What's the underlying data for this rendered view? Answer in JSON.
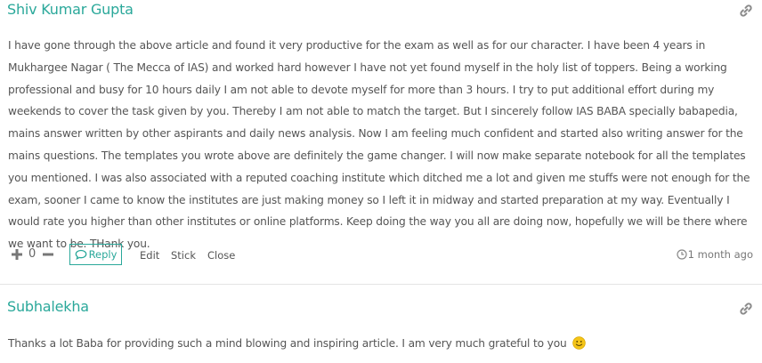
{
  "comments": [
    {
      "author": "Shiv Kumar Gupta",
      "body": "I have gone through the above article and found it very productive for the exam as well as for our character. I have been 4 years in Mukhargee Nagar ( The Mecca of IAS) and worked hard however I have not yet found myself in the holy list of toppers. Being a working professional and busy for 10 hours daily I am not able to devote myself for more than 3 hours. I try to put additional effort during my weekends to cover the task given by you. Thereby I am not able to match the target. But I sincerely follow IAS BABA specially babapedia, mains answer written by other aspirants and daily news analysis. Now I am feeling much confident and started also writing answer for the mains questions. The templates you wrote above are definitely the game changer. I will now make separate notebook for all the templates you mentioned. I was also associated with a reputed coaching institute which ditched me a lot and given me stuffs were not enough for the exam, sooner I came to know the institutes are just making money so I left it in midway and started preparation at my way. Eventually I would rate you higher than other institutes or online platforms. Keep doing the way you all are doing now, hopefully we will be there where we want to be. THank you.",
      "votes": "0",
      "reply_label": "Reply",
      "edit_label": "Edit",
      "stick_label": "Stick",
      "close_label": "Close",
      "time": "1 month ago"
    },
    {
      "author": "Subhalekha",
      "body": "Thanks a lot Baba for providing such a mind blowing and inspiring article. I am very much grateful to you"
    }
  ],
  "colors": {
    "accent": "#2aa89a",
    "text": "#555555",
    "icon": "#888888",
    "emoji": "#f5c518"
  },
  "icons": [
    "link-icon",
    "plus-icon",
    "minus-icon",
    "reply-icon",
    "clock-icon",
    "smiley-icon"
  ]
}
